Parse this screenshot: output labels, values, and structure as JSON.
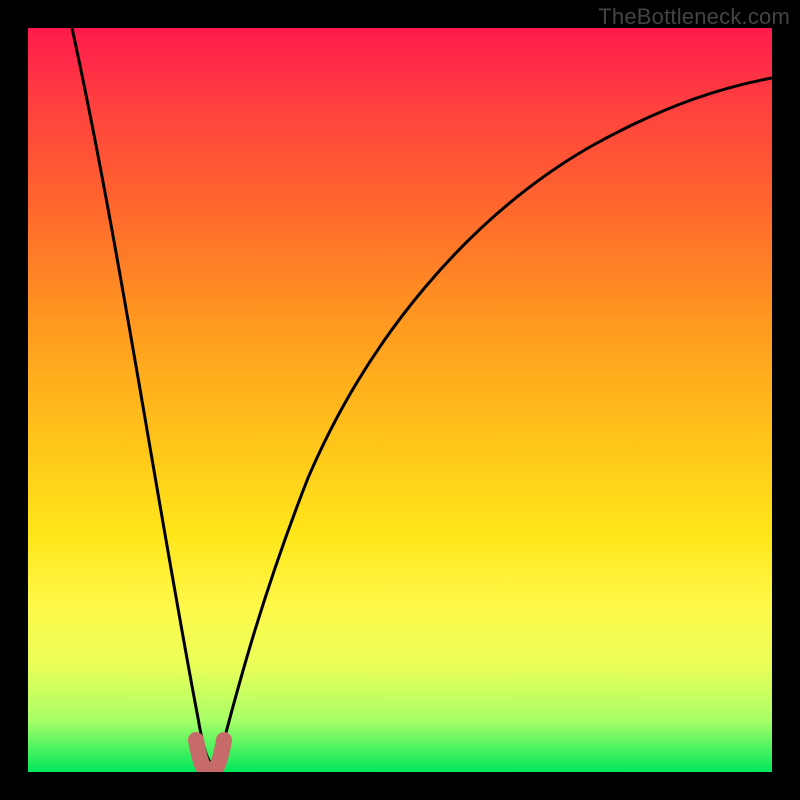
{
  "attribution": "TheBottleneck.com",
  "chart_data": {
    "type": "line",
    "title": "",
    "xlabel": "",
    "ylabel": "",
    "xlim": [
      0,
      100
    ],
    "ylim": [
      0,
      100
    ],
    "series": [
      {
        "name": "left-branch",
        "x": [
          5,
          8,
          11,
          14,
          17,
          20,
          23
        ],
        "values": [
          100,
          80,
          60,
          40,
          22,
          6,
          0
        ]
      },
      {
        "name": "right-branch",
        "x": [
          25,
          28,
          32,
          38,
          45,
          55,
          65,
          75,
          85,
          95,
          100
        ],
        "values": [
          0,
          8,
          22,
          40,
          55,
          68,
          77,
          83,
          88,
          91,
          92
        ]
      },
      {
        "name": "valley-marker",
        "x": [
          22,
          23,
          24,
          25,
          26
        ],
        "values": [
          4,
          1,
          0,
          1,
          4
        ]
      }
    ],
    "colors": {
      "curve": "#000000",
      "valley_marker": "#c76a6a"
    }
  }
}
